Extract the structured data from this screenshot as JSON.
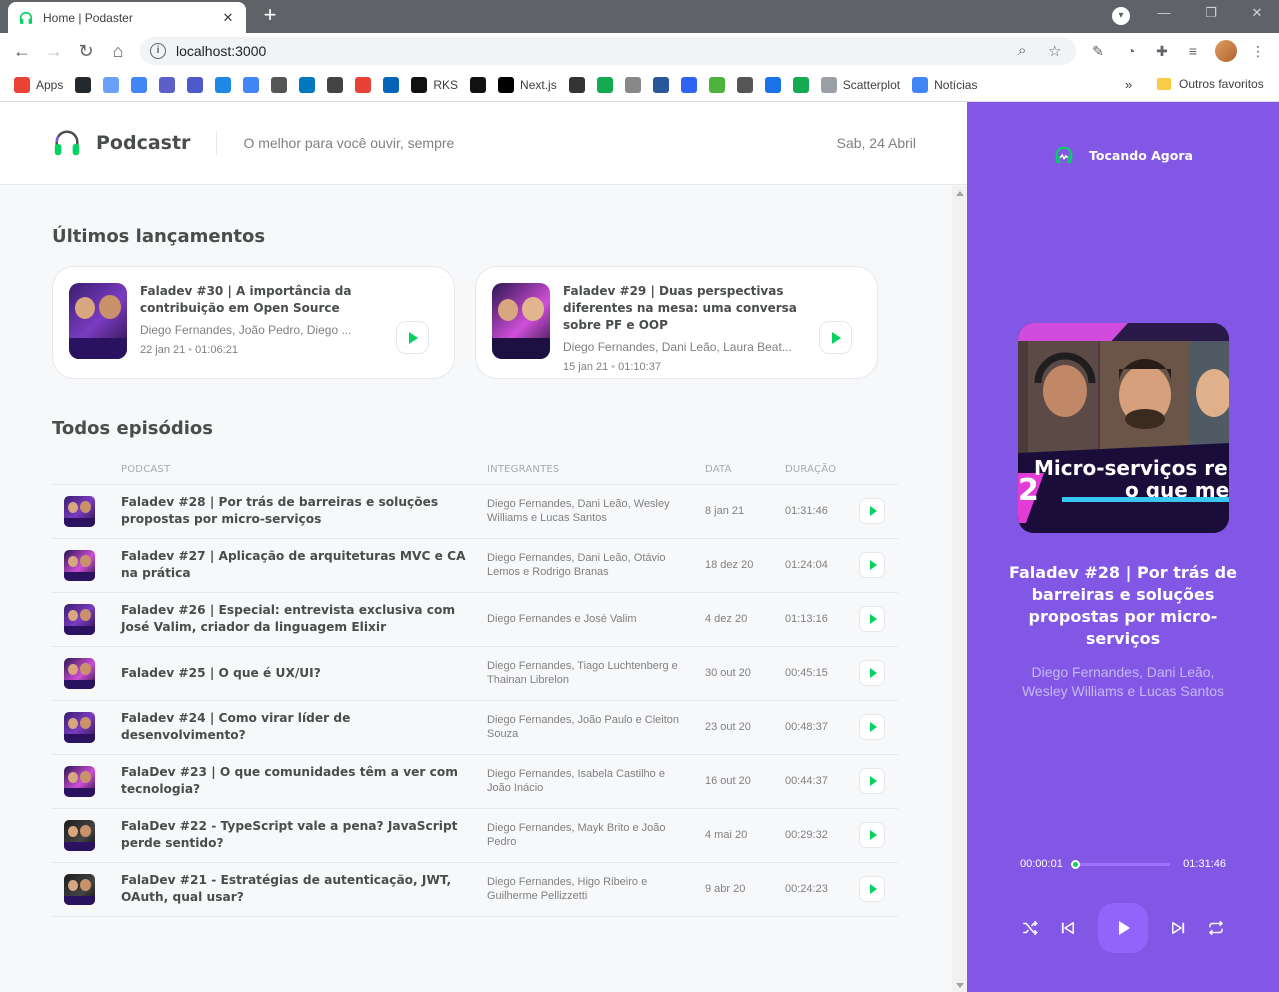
{
  "browser": {
    "tab_title": "Home | Podaster",
    "tab_close": "✕",
    "new_tab": "+",
    "url": "localhost:3000",
    "bookmarks": [
      {
        "label": "Apps",
        "color": "#ea4335"
      },
      {
        "label": "",
        "color": "#24292e"
      },
      {
        "label": "",
        "color": "#6aa0f8"
      },
      {
        "label": "",
        "color": "#4285f4"
      },
      {
        "label": "",
        "color": "#5b5fc7"
      },
      {
        "label": "",
        "color": "#5059c9"
      },
      {
        "label": "",
        "color": "#1e88e5"
      },
      {
        "label": "",
        "color": "#4285f4"
      },
      {
        "label": "",
        "color": "#555555"
      },
      {
        "label": "",
        "color": "#0079bf"
      },
      {
        "label": "",
        "color": "#444444"
      },
      {
        "label": "",
        "color": "#e94235"
      },
      {
        "label": "",
        "color": "#0364b8"
      },
      {
        "label": "RKS",
        "color": "#111111"
      },
      {
        "label": "",
        "color": "#111111"
      },
      {
        "label": "Next.js",
        "color": "#000000"
      },
      {
        "label": "",
        "color": "#333333"
      },
      {
        "label": "",
        "color": "#13aa52"
      },
      {
        "label": "",
        "color": "#888888"
      },
      {
        "label": "",
        "color": "#2b579a"
      },
      {
        "label": "",
        "color": "#2f64f5"
      },
      {
        "label": "",
        "color": "#4db33d"
      },
      {
        "label": "",
        "color": "#555555"
      },
      {
        "label": "",
        "color": "#1a73e8"
      },
      {
        "label": "",
        "color": "#13aa52"
      },
      {
        "label": "Scatterplot",
        "color": "#9aa0a6"
      },
      {
        "label": "Notícias",
        "color": "#4285f4"
      }
    ],
    "more": "»",
    "other_bookmarks": "Outros favoritos"
  },
  "header": {
    "brand": "Podcastr",
    "tagline": "O melhor para você ouvir, sempre",
    "date": "Sab, 24 Abril"
  },
  "latest": {
    "heading": "Últimos lançamentos",
    "episodes": [
      {
        "title": "Faladev #30 | A importância da contribuição em Open Source",
        "members": "Diego Fernandes, João Pedro, Diego ...",
        "date": "22 jan 21",
        "duration": "01:06:21"
      },
      {
        "title": "Faladev #29 | Duas perspectivas diferentes na mesa: uma conversa sobre PF e OOP",
        "members": "Diego Fernandes, Dani Leão, Laura Beat...",
        "date": "15 jan 21",
        "duration": "01:10:37"
      }
    ]
  },
  "all": {
    "heading": "Todos episódios",
    "columns": [
      "Podcast",
      "Integrantes",
      "Data",
      "Duração"
    ],
    "episodes": [
      {
        "title": "Faladev #28 | Por trás de barreiras e soluções propostas por micro-serviços",
        "members": "Diego Fernandes, Dani Leão, Wesley Williams e Lucas Santos",
        "date": "8 jan 21",
        "duration": "01:31:46"
      },
      {
        "title": "Faladev #27 | Aplicação de arquiteturas MVC e CA na prática",
        "members": "Diego Fernandes, Dani Leão, Otávio Lemos e Rodrigo Branas",
        "date": "18 dez 20",
        "duration": "01:24:04"
      },
      {
        "title": "Faladev #26 | Especial: entrevista exclusiva com José Valim, criador da linguagem Elixir",
        "members": "Diego Fernandes e José Valim",
        "date": "4 dez 20",
        "duration": "01:13:16"
      },
      {
        "title": "Faladev #25 | O que é UX/UI?",
        "members": "Diego Fernandes, Tiago Luchtenberg e Thainan Librelon",
        "date": "30 out 20",
        "duration": "00:45:15"
      },
      {
        "title": "Faladev #24 | Como virar líder de desenvolvimento?",
        "members": "Diego Fernandes, João Paulo e Cleiton Souza",
        "date": "23 out 20",
        "duration": "00:48:37"
      },
      {
        "title": "FalaDev #23 | O que comunidades têm a ver com tecnologia?",
        "members": "Diego Fernandes, Isabela Castilho e João Inácio",
        "date": "16 out 20",
        "duration": "00:44:37"
      },
      {
        "title": "FalaDev #22 - TypeScript vale a pena? JavaScript perde sentido?",
        "members": "Diego Fernandes, Mayk Brito e João Pedro",
        "date": "4 mai 20",
        "duration": "00:29:32"
      },
      {
        "title": "FalaDev #21 - Estratégias de autenticação, JWT, OAuth, qual usar?",
        "members": "Diego Fernandes, Higo Ribeiro e Guilherme Pellizzetti",
        "date": "9 abr 20",
        "duration": "00:24:23"
      }
    ]
  },
  "player": {
    "heading": "Tocando Agora",
    "title": "Faladev #28 | Por trás de barreiras e soluções propostas por micro-serviços",
    "members": "Diego Fernandes, Dani Leão, Wesley Williams e Lucas Santos",
    "cover_text_1": "Micro-serviços re",
    "cover_text_2": "o que me",
    "cover_num": "2",
    "current_time": "00:00:01",
    "total_time": "01:31:46",
    "progress": 0.0
  },
  "colors": {
    "accent": "#8257e5",
    "play_green": "#04d361"
  }
}
